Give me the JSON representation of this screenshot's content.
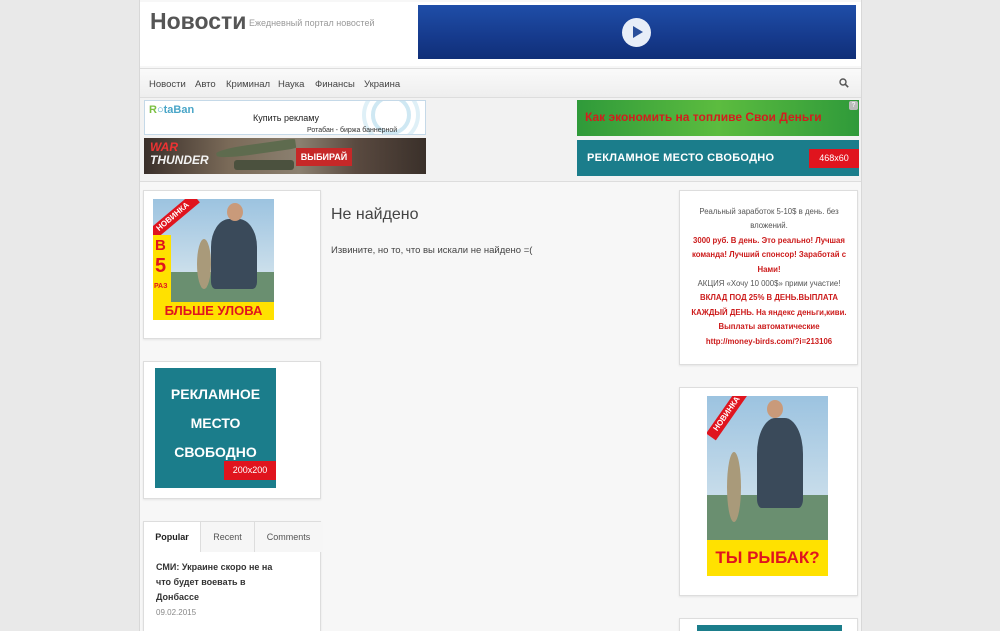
{
  "header": {
    "site_title": "Новости",
    "site_description": "Ежедневный портал новостей"
  },
  "nav": {
    "items": [
      "Новости",
      "Авто",
      "Криминал",
      "Наука",
      "Финансы",
      "Украина"
    ],
    "search_icon": "search-icon"
  },
  "banners": {
    "rotaban": {
      "logo_a": "R",
      "logo_b": "taBan",
      "title": "Купить рекламу",
      "subtitle": "Ротабан - биржа баннерной рекламы"
    },
    "warthunder": {
      "logo_line1": "WAR",
      "logo_line2": "THUNDER",
      "button": "ВЫБИРАЙ"
    },
    "fuel_ad": {
      "text": "Как экономить на топливе Свои Деньги",
      "badge": "?"
    },
    "ad_468": {
      "text": "РЕКЛАМНОЕ  МЕСТО СВОБОДНО",
      "size": "468x60"
    }
  },
  "left_sidebar": {
    "fishing_banner_1": {
      "ribbon": "НОВИНКА",
      "big_letter": "В",
      "big_number": "5",
      "small_word": "РАЗ",
      "caption": "БЛЬШЕ УЛОВА"
    },
    "ad_200": {
      "line1": "РЕКЛАМНОЕ",
      "line2": "МЕСТО",
      "line3": "СВОБОДНО",
      "size": "200x200"
    },
    "tabs": {
      "items": [
        "Popular",
        "Recent",
        "Comments"
      ],
      "active": 0,
      "post": {
        "title": "СМИ: Украине скоро не на что будет воевать в Донбассе",
        "date": "09.02.2015"
      }
    }
  },
  "main": {
    "title": "Не найдено",
    "message": "Извините, но то, что вы искали не найдено =("
  },
  "right_sidebar": {
    "promo": {
      "line1": "Реальный заработок 5-10$ в день. без вложений.",
      "line2": "3000 руб. В день. Это реально! Лучшая команда! Лучший спонсор! Заработай с Нами!",
      "line3": "АКЦИЯ «Хочу 10 000$» прими участие!",
      "line4": "ВКЛАД ПОД 25% В ДЕНЬ.ВЫПЛАТА КАЖДЫЙ ДЕНЬ. На яндекс деньги,киви. Выплаты автоматические",
      "line5": "http://money-birds.com/?i=213106"
    },
    "fishing_banner_2": {
      "ribbon": "НОВИНКА",
      "caption": "ТЫ РЫБАК?"
    }
  },
  "colors": {
    "accent_red": "#e0141e",
    "teal_ad": "#1b7d8b",
    "promo_red": "#cc1b1b",
    "banner_yellow": "#ffe100"
  }
}
